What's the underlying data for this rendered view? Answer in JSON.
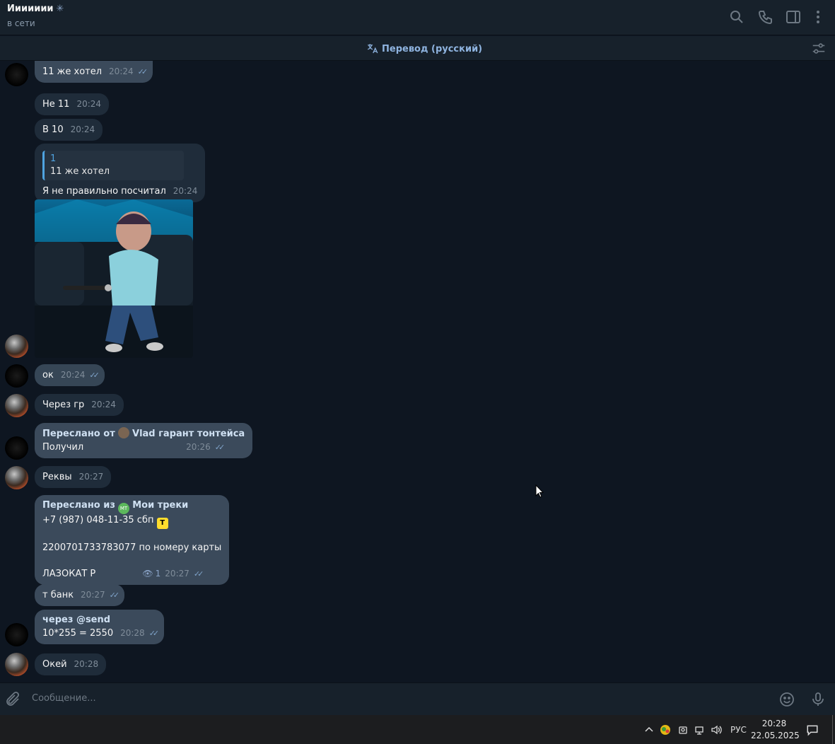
{
  "header": {
    "chat_name": "Иииииии",
    "status": "в сети"
  },
  "translate_bar": {
    "label": "Перевод (русский)"
  },
  "messages": [
    {
      "text": "11 же хотел",
      "time": "20:24",
      "read": true
    },
    {
      "text": "Не 11",
      "time": "20:24"
    },
    {
      "text": "В 10",
      "time": "20:24"
    },
    {
      "reply_author": "1",
      "reply_text": "11 же хотел",
      "text": "Я не правильно посчитал",
      "time": "20:24"
    },
    {
      "text": "ок",
      "time": "20:24",
      "read": true
    },
    {
      "text": "Через гр",
      "time": "20:24"
    },
    {
      "forward_label": "Переслано от",
      "forward_name": "Vlad гарант тонтейса",
      "text": "Получил",
      "time": "20:26",
      "read": true
    },
    {
      "text": "Реквы",
      "time": "20:27"
    },
    {
      "forward_label": "Переслано из",
      "forward_name": "Мои треки",
      "line1": "+7 (987) 048-11-35 сбп",
      "line2": "2200701733783077 по номеру карты",
      "line3": "ЛАЗОКАТ Р",
      "views": "1",
      "time": "20:27",
      "read": true
    },
    {
      "text": "т банк",
      "time": "20:27",
      "read": true
    },
    {
      "title": "через @send",
      "text": "10*255 = 2550",
      "time": "20:28",
      "read": true
    },
    {
      "text": "Окей",
      "time": "20:28"
    }
  ],
  "input": {
    "placeholder": "Сообщение..."
  },
  "taskbar": {
    "language": "РУС",
    "time": "20:28",
    "date": "22.05.2025"
  },
  "colors": {
    "background": "#0e1621",
    "header": "#17212b",
    "bubble_in": "#182533",
    "bubble_out": "#2b5278",
    "accent": "#4fa3e0"
  }
}
